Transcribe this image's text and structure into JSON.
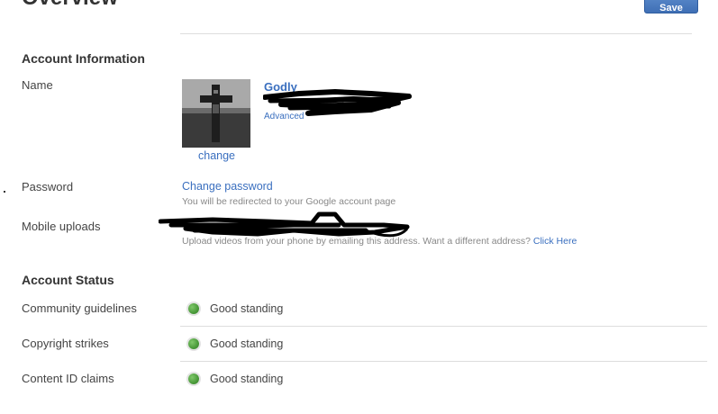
{
  "header": {
    "title": "Overview",
    "save_label": "Save"
  },
  "account_information": {
    "heading": "Account Information",
    "name_label": "Name",
    "user_name": "Godly",
    "advanced_link": "Advanced",
    "change_photo_link": "change",
    "password_label": "Password",
    "change_password_link": "Change password",
    "password_hint": "You will be redirected to your Google account page",
    "mobile_uploads_label": "Mobile uploads",
    "mobile_uploads_hint": "Upload videos from your phone by emailing this address. Want a different address?",
    "mobile_uploads_link": "Click Here"
  },
  "account_status": {
    "heading": "Account Status",
    "rows": [
      {
        "label": "Community guidelines",
        "status": "Good standing"
      },
      {
        "label": "Copyright strikes",
        "status": "Good standing"
      },
      {
        "label": "Content ID claims",
        "status": "Good standing"
      }
    ]
  },
  "colors": {
    "link": "#3a6fbf",
    "save_button": "#3f6fb5",
    "status_good": "#4a9a3a"
  },
  "icons": {
    "status": "green-dot-icon",
    "avatar": "cross-image"
  }
}
